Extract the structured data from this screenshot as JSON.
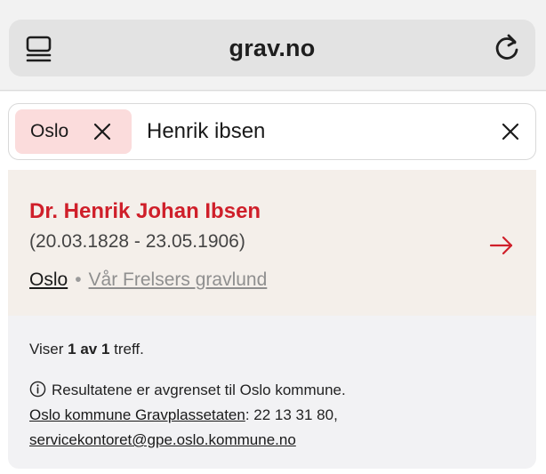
{
  "browser": {
    "domain": "grav.no"
  },
  "search": {
    "filter_chip": "Oslo",
    "query": "Henrik ibsen"
  },
  "result": {
    "name": "Dr. Henrik Johan Ibsen",
    "dates": "(20.03.1828 - 23.05.1906)",
    "location_city": "Oslo",
    "separator": "•",
    "cemetery": "Vår Frelsers gravlund"
  },
  "info": {
    "count_prefix": "Viser ",
    "count_bold": "1 av 1",
    "count_suffix": " treff.",
    "notice": "Resultatene er avgrenset til Oslo kommune.",
    "agency_link": "Oslo kommune Gravplassetaten",
    "phone": ": 22 13 31 80,",
    "email_link": "servicekontoret@gpe.oslo.kommune.no"
  },
  "colors": {
    "accent_red": "#cf1f2a",
    "chip_bg": "#fbdcdc",
    "result_bg": "#f4efea"
  },
  "icons": {
    "tabs": "tabs-icon",
    "reload": "reload-icon",
    "chip_remove": "close-icon",
    "clear": "close-icon",
    "open": "arrow-right-icon",
    "info": "info-icon"
  }
}
